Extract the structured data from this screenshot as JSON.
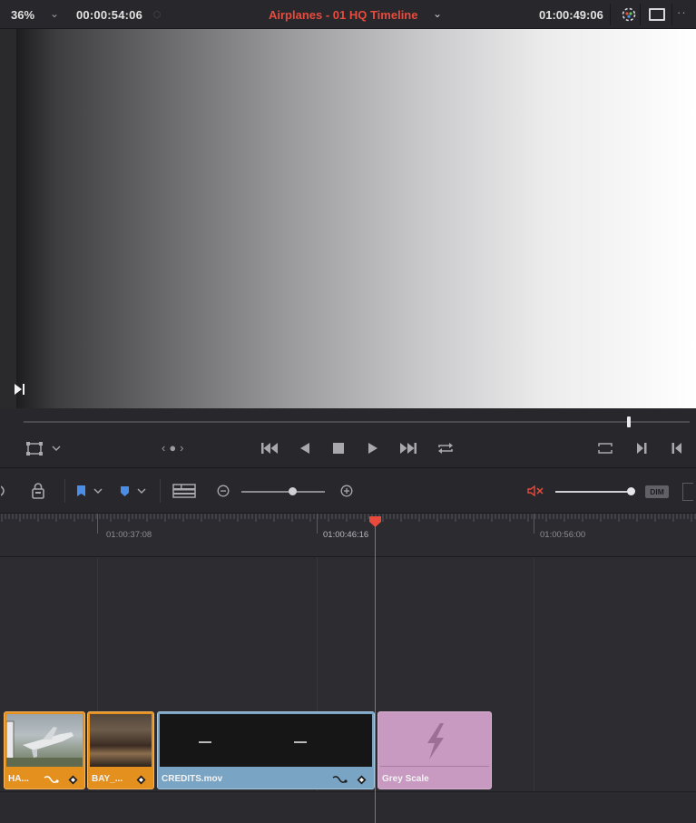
{
  "header": {
    "zoom": "36%",
    "source_timecode": "00:00:54:06",
    "timeline_name": "Airplanes - 01 HQ Timeline",
    "record_timecode": "01:00:49:06"
  },
  "timeline_toolbar": {
    "dim_label": "DIM"
  },
  "ruler": {
    "timecodes": [
      "01:00:37:08",
      "01:00:46:16",
      "01:00:56:00"
    ]
  },
  "clips": [
    {
      "label": "HA..."
    },
    {
      "label": "BAY_..."
    },
    {
      "label": "CREDITS.mov"
    },
    {
      "label": "Grey Scale"
    }
  ],
  "colors": {
    "accent_red": "#e84a3c",
    "clip_orange": "#e4901f",
    "clip_blue": "#7aa4c4",
    "clip_purple": "#c89ac2"
  },
  "icons": [
    "chevron-down-icon",
    "color-picker-icon",
    "single-viewer-icon",
    "more-icon",
    "safe-area-icon",
    "jog-icon",
    "go-to-first-frame-icon",
    "play-reverse-icon",
    "stop-icon",
    "play-icon",
    "go-to-last-frame-icon",
    "loop-icon",
    "match-frame-icon",
    "mark-out-icon",
    "mark-in-icon",
    "lock-icon",
    "flag-icon",
    "marker-icon",
    "timeline-view-options-icon",
    "zoom-out-icon",
    "zoom-in-icon",
    "mute-icon",
    "playhead-icon",
    "transition-icon",
    "keyframe-icon",
    "generator-icon"
  ]
}
